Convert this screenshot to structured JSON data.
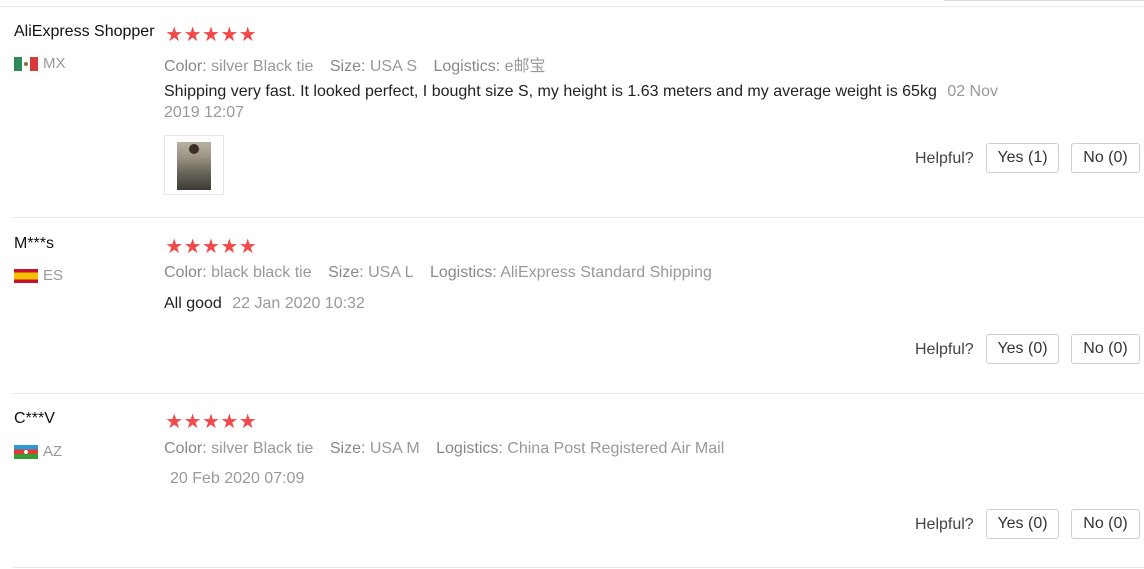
{
  "labels": {
    "color": "Color:",
    "size": "Size:",
    "logistics": "Logistics:",
    "helpful": "Helpful?"
  },
  "star_glyph": "★",
  "colors": {
    "star": "#f04a4a",
    "muted": "#999999"
  },
  "reviews": [
    {
      "user": "AliExpress Shopper",
      "country": "MX",
      "rating": 5,
      "color": "silver Black tie",
      "size": "USA S",
      "logistics": "e邮宝",
      "text": "Shipping very fast. It looked perfect, I bought size S, my height is 1.63 meters and my average weight is 65kg",
      "date": "02 Nov 2019 12:07",
      "yes": "Yes (1)",
      "no": "No (0)"
    },
    {
      "user": "M***s",
      "country": "ES",
      "rating": 5,
      "color": "black black tie",
      "size": "USA L",
      "logistics": "AliExpress Standard Shipping",
      "text": "All good",
      "date": "22 Jan 2020 10:32",
      "yes": "Yes (0)",
      "no": "No (0)"
    },
    {
      "user": "C***V",
      "country": "AZ",
      "rating": 5,
      "color": "silver Black tie",
      "size": "USA M",
      "logistics": "China Post Registered Air Mail",
      "text": "",
      "date": "20 Feb 2020 07:09",
      "yes": "Yes (0)",
      "no": "No (0)"
    }
  ]
}
